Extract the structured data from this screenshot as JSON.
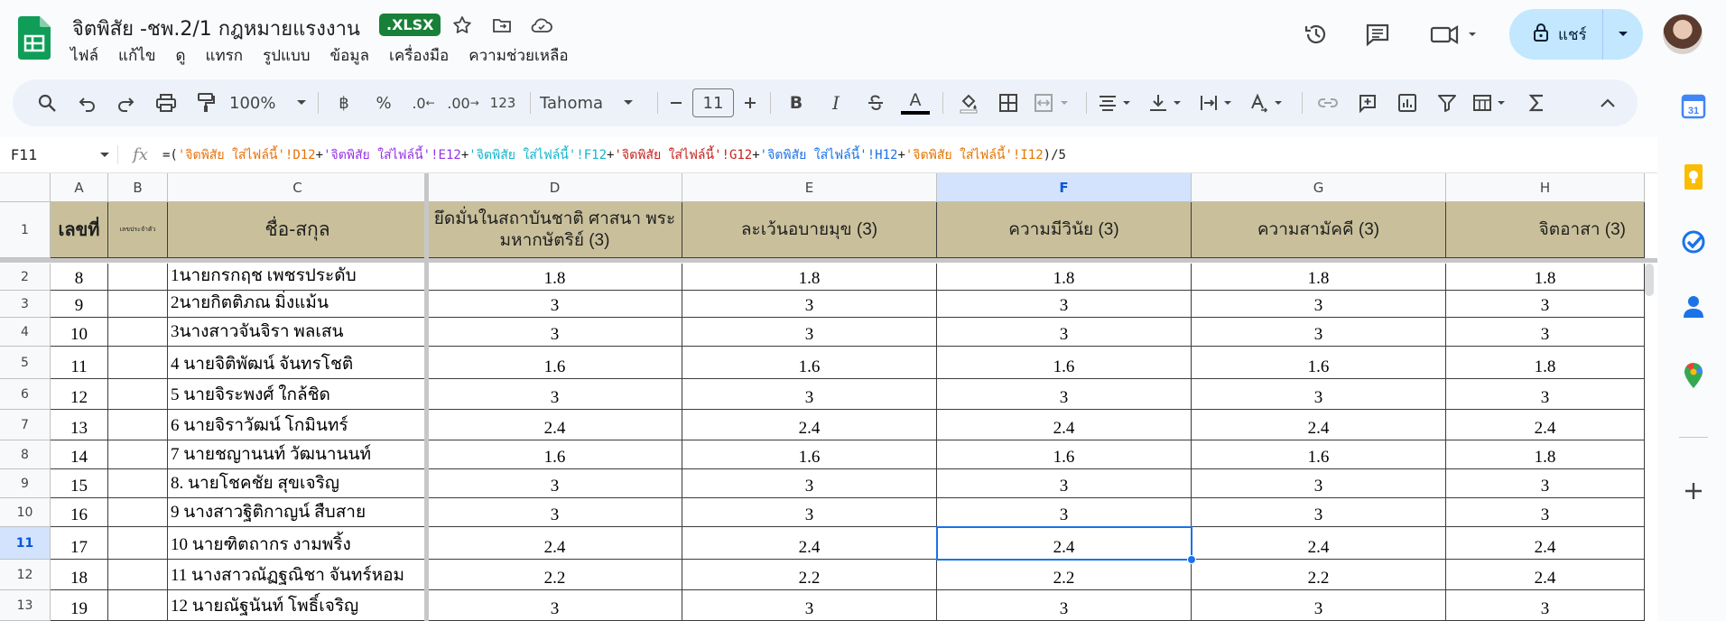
{
  "doc": {
    "title": "จิตพิสัย -ชพ.2/1 กฎหมายแรงงาน",
    "badge": ".XLSX"
  },
  "menu": [
    "ไฟล์",
    "แก้ไข",
    "ดู",
    "แทรก",
    "รูปแบบ",
    "ข้อมูล",
    "เครื่องมือ",
    "ความช่วยเหลือ"
  ],
  "share_label": "แชร์",
  "toolbar": {
    "zoom": "100%",
    "currency": "฿",
    "percent": "%",
    "dec_less": ".0",
    "dec_more": ".00",
    "format_123": "123",
    "font": "Tahoma",
    "font_size": "11",
    "bold": "B",
    "italic": "I",
    "text_color": "A"
  },
  "namebox": "F11",
  "formula": {
    "parts": [
      {
        "t": "=(",
        "c": "#1f1f1f"
      },
      {
        "t": "'จิตพิสัย ใส่ไฟล์นี้'!D12",
        "c": "#e8710a"
      },
      {
        "t": "+",
        "c": "#1f1f1f"
      },
      {
        "t": "'จิตพิสัย ใส่ไฟล์นี้'!E12",
        "c": "#9334e6"
      },
      {
        "t": "+",
        "c": "#1f1f1f"
      },
      {
        "t": "'จิตพิสัย ใส่ไฟล์นี้'!F12",
        "c": "#12b5cb"
      },
      {
        "t": "+",
        "c": "#1f1f1f"
      },
      {
        "t": "'จิตพิสัย ใส่ไฟล์นี้'!G12",
        "c": "#c5221f"
      },
      {
        "t": "+",
        "c": "#1f1f1f"
      },
      {
        "t": "'จิตพิสัย ใส่ไฟล์นี้'!H12",
        "c": "#1a73e8"
      },
      {
        "t": "+",
        "c": "#1f1f1f"
      },
      {
        "t": "'จิตพิสัย ใส่ไฟล์นี้'!I12",
        "c": "#e37400"
      },
      {
        "t": ")/5",
        "c": "#1f1f1f"
      }
    ]
  },
  "columns": [
    "A",
    "B",
    "C",
    "D",
    "E",
    "F",
    "G",
    "H"
  ],
  "selected_column": "F",
  "selected_row": "11",
  "header_row": {
    "A": "เลขที่",
    "B": "เลขประจำตัว",
    "C": "ชื่อ-สกุล",
    "D": "ยึดมั่นในสถาบันชาติ ศาสนา พระมหากษัตริย์ (3)",
    "E": "ละเว้นอบายมุข (3)",
    "F": "ความมีวินัย (3)",
    "G": "ความสามัคคี (3)",
    "H": "จิตอาสา (3)"
  },
  "rows": [
    {
      "n": "2",
      "A": "8",
      "B": "",
      "C": "1นายกรกฤช  เพชรประดับ",
      "D": "1.8",
      "E": "1.8",
      "F": "1.8",
      "G": "1.8",
      "H": "1.8"
    },
    {
      "n": "3",
      "A": "9",
      "B": "",
      "C": "2นายกิตติภณ มิ่งแม้น",
      "D": "3",
      "E": "3",
      "F": "3",
      "G": "3",
      "H": "3"
    },
    {
      "n": "4",
      "A": "10",
      "B": "",
      "C": "3นางสาวจันจิรา  พลเสน",
      "D": "3",
      "E": "3",
      "F": "3",
      "G": "3",
      "H": "3"
    },
    {
      "n": "5",
      "A": "11",
      "B": "",
      "C": "4 นายจิติพัฒน์  จันทรโชติ",
      "D": "1.6",
      "E": "1.6",
      "F": "1.6",
      "G": "1.6",
      "H": "1.8"
    },
    {
      "n": "6",
      "A": "12",
      "B": "",
      "C": "5 นายจิระพงศ์  ใกล้ชิด",
      "D": "3",
      "E": "3",
      "F": "3",
      "G": "3",
      "H": "3"
    },
    {
      "n": "7",
      "A": "13",
      "B": "",
      "C": "6 นายจิราวัฒน์  โกมินทร์",
      "D": "2.4",
      "E": "2.4",
      "F": "2.4",
      "G": "2.4",
      "H": "2.4"
    },
    {
      "n": "8",
      "A": "14",
      "B": "",
      "C": "7 นายชญานนท์  วัฒนานนท์",
      "D": "1.6",
      "E": "1.6",
      "F": "1.6",
      "G": "1.6",
      "H": "1.8"
    },
    {
      "n": "9",
      "A": "15",
      "B": "",
      "C": "8. นายโชคชัย  สุขเจริญ",
      "D": "3",
      "E": "3",
      "F": "3",
      "G": "3",
      "H": "3"
    },
    {
      "n": "10",
      "A": "16",
      "B": "",
      "C": "9 นางสาวฐิติกาญน์  สืบสาย",
      "D": "3",
      "E": "3",
      "F": "3",
      "G": "3",
      "H": "3"
    },
    {
      "n": "11",
      "A": "17",
      "B": "",
      "C": "10 นายฑิตถากร  งามพริ้ง",
      "D": "2.4",
      "E": "2.4",
      "F": "2.4",
      "G": "2.4",
      "H": "2.4"
    },
    {
      "n": "12",
      "A": "18",
      "B": "",
      "C": "11 นางสาวณัฏฐณิชา  จันทร์หอม",
      "D": "2.2",
      "E": "2.2",
      "F": "2.2",
      "G": "2.2",
      "H": "2.4"
    },
    {
      "n": "13",
      "A": "19",
      "B": "",
      "C": "12 นายณัฐนันท์  โพธิ์เจริญ",
      "D": "3",
      "E": "3",
      "F": "3",
      "G": "3",
      "H": "3"
    }
  ],
  "colors": {
    "header_fill": "#c9c09b",
    "selection": "#1a73e8",
    "badge": "#188038",
    "share_bg": "#c2e7ff"
  }
}
